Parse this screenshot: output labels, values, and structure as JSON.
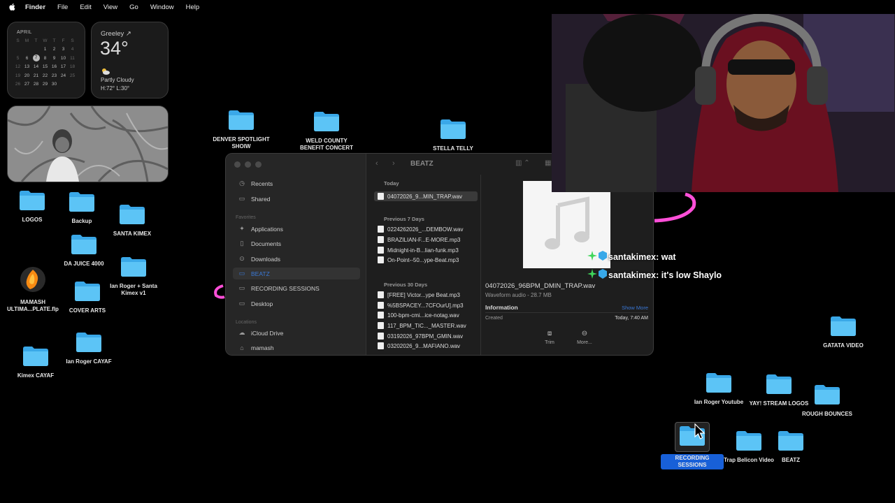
{
  "menubar": {
    "items": [
      "Finder",
      "File",
      "Edit",
      "View",
      "Go",
      "Window",
      "Help"
    ]
  },
  "calendar": {
    "month": "APRIL",
    "weekdays": [
      "S",
      "M",
      "T",
      "W",
      "T",
      "F",
      "S"
    ],
    "rows": [
      [
        "",
        "",
        "",
        "1",
        "2",
        "3",
        "4"
      ],
      [
        "5",
        "6",
        "7",
        "8",
        "9",
        "10",
        "11"
      ],
      [
        "12",
        "13",
        "14",
        "15",
        "16",
        "17",
        "18"
      ],
      [
        "19",
        "20",
        "21",
        "22",
        "23",
        "24",
        "25"
      ],
      [
        "26",
        "27",
        "28",
        "29",
        "30",
        "",
        ""
      ]
    ],
    "today": "7"
  },
  "weather": {
    "city": "Greeley ↗",
    "temp": "34°",
    "condition": "Partly Cloudy",
    "hilo": "H:72° L:30°"
  },
  "desktop_icons": [
    {
      "label": "DENVER SPOTLIGHT SHOIW"
    },
    {
      "label": "WELD COUNTY BENEFIT CONCERT"
    },
    {
      "label": "STELLA TELLY"
    },
    {
      "label": "LOGOS"
    },
    {
      "label": "Backup"
    },
    {
      "label": "SANTA KIMEX"
    },
    {
      "label": "DA JUICE 4000"
    },
    {
      "label": "MAMASH ULTIMA...PLATE.flp"
    },
    {
      "label": "COVER ARTS"
    },
    {
      "label": "Ian Roger + Santa Kimex v1"
    },
    {
      "label": "Kimex CAYAF"
    },
    {
      "label": "Ian Roger CAYAF"
    },
    {
      "label": "GATATA VIDEO"
    },
    {
      "label": "Ian Roger Youtube"
    },
    {
      "label": "YAY! STREAM LOGOS"
    },
    {
      "label": "ROUGH BOUNCES"
    },
    {
      "label": "RECORDING SESSIONS"
    },
    {
      "label": "Trap Belicon Video"
    },
    {
      "label": "BEATZ"
    }
  ],
  "finder": {
    "title": "BEATZ",
    "sidebar": {
      "top": [
        {
          "label": "Recents",
          "icon": "clock-icon"
        },
        {
          "label": "Shared",
          "icon": "folder-shared-icon"
        }
      ],
      "favorites_header": "Favorites",
      "favorites": [
        {
          "label": "Applications",
          "icon": "apps-icon"
        },
        {
          "label": "Documents",
          "icon": "document-icon"
        },
        {
          "label": "Downloads",
          "icon": "download-icon"
        },
        {
          "label": "BEATZ",
          "icon": "folder-icon"
        },
        {
          "label": "RECORDING SESSIONS",
          "icon": "folder-icon"
        },
        {
          "label": "Desktop",
          "icon": "desktop-icon"
        }
      ],
      "locations_header": "Locations",
      "locations": [
        {
          "label": "iCloud Drive",
          "icon": "cloud-icon"
        },
        {
          "label": "mamash",
          "icon": "home-icon"
        }
      ]
    },
    "groups": [
      {
        "header": "Today",
        "files": [
          "04072026_9...MIN_TRAP.wav"
        ]
      },
      {
        "header": "Previous 7 Days",
        "files": [
          "0224262026_...DEMBOW.wav",
          "BRAZILIAN-F...E-MORE.mp3",
          "Midnight-in-B...lian-funk.mp3",
          "On-Point--50...ype-Beat.mp3"
        ]
      },
      {
        "header": "Previous 30 Days",
        "files": [
          "[FREE] Victor...ype Beat.mp3",
          "%5BSPACEY...7CFOurU].mp3",
          "100-bpm-cmi...ice-notag.wav",
          "117_BPM_TIC..._MASTER.wav",
          "03192026_97BPM_GMIN.wav",
          "03202026_9...MAFIANO.wav"
        ]
      }
    ],
    "preview": {
      "name": "04072026_96BPM_DMIN_TRAP.wav",
      "kind": "Waveform audio - 28.7 MB",
      "info_header": "Information",
      "show_more": "Show More",
      "created_label": "Created",
      "created_value": "Today, 7:40 AM",
      "actions": [
        {
          "label": "Trim"
        },
        {
          "label": "More..."
        }
      ]
    }
  },
  "chat": [
    {
      "user": "santakimex:",
      "message": "wat"
    },
    {
      "user": "santakimex:",
      "message": "it's low Shaylo"
    }
  ]
}
